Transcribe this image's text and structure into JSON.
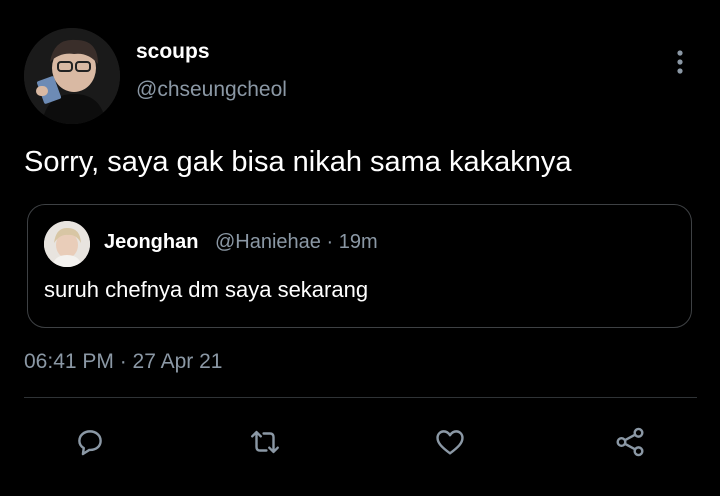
{
  "tweet": {
    "display_name": "scoups",
    "handle": "@chseungcheol",
    "text": "Sorry, saya gak bisa nikah sama kakaknya",
    "timestamp": "06:41 PM · 27 Apr 21"
  },
  "quoted_tweet": {
    "display_name": "Jeonghan",
    "meta": "@Haniehae · 19m",
    "text": "suruh chefnya dm saya sekarang"
  },
  "actions": [
    "reply-icon",
    "retweet-icon",
    "like-icon",
    "share-icon"
  ],
  "colors": {
    "background": "#000000",
    "text": "#e7e9ea",
    "secondary": "#8b98a5",
    "border": "#3e4144"
  }
}
